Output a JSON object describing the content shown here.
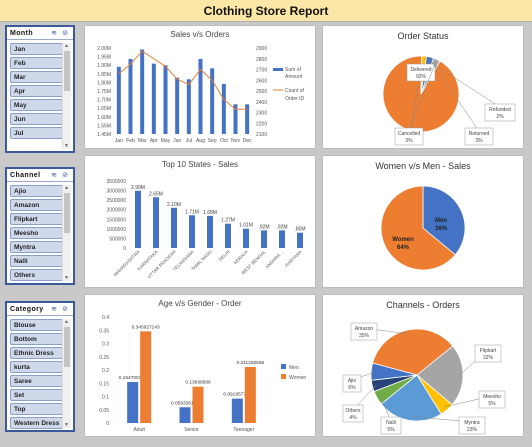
{
  "report": {
    "title": "Clothing Store Report"
  },
  "slicers": {
    "month": {
      "title": "Month",
      "items": [
        "Jan",
        "Feb",
        "Mar",
        "Apr",
        "May",
        "Jun",
        "Jul"
      ]
    },
    "channel": {
      "title": "Channel",
      "items": [
        "Ajio",
        "Amazon",
        "Flipkart",
        "Meesho",
        "Myntra",
        "Nalli",
        "Others"
      ]
    },
    "category": {
      "title": "Category",
      "items": [
        "Blouse",
        "Bottom",
        "Ethnic Dress",
        "kurta",
        "Saree",
        "Set",
        "Top",
        "Western Dress"
      ]
    }
  },
  "panels": {
    "sales_orders": {
      "title": "Sales v/s Orders"
    },
    "order_status": {
      "title": "Order Status"
    },
    "top_states": {
      "title": "Top 10 States - Sales"
    },
    "women_men": {
      "title": "Women v/s Men - Sales"
    },
    "age_gender": {
      "title": "Age v/s Gender - Order"
    },
    "channels": {
      "title": "Channels - Orders"
    }
  },
  "chart_data": [
    {
      "id": "sales_orders",
      "type": "bar",
      "title": "Sales v/s Orders",
      "categories": [
        "Jan",
        "Feb",
        "Mar",
        "Apr",
        "May",
        "Jun",
        "Jul",
        "Aug",
        "Sep",
        "Oct",
        "Nov",
        "Dec"
      ],
      "series": [
        {
          "name": "Sum of Amount",
          "type": "bar",
          "color": "#4472c4",
          "values": [
            1.88,
            1.93,
            1.99,
            1.9,
            1.89,
            1.81,
            1.8,
            1.93,
            1.87,
            1.77,
            1.64,
            1.64
          ]
        },
        {
          "name": "Count of Order ID",
          "type": "line",
          "color": "#ed7d31",
          "values": [
            2660,
            2750,
            2870,
            2800,
            2730,
            2610,
            2560,
            2700,
            2600,
            2420,
            2330,
            2330
          ]
        }
      ],
      "ylim": [
        1.45,
        2.0
      ],
      "y_ticks": [
        "1.45M",
        "1.55M",
        "1.60M",
        "1.65M",
        "1.70M",
        "1.75M",
        "1.80M",
        "1.85M",
        "1.90M",
        "1.95M",
        "2.00M"
      ],
      "y2lim": [
        2100,
        2900
      ],
      "y2_ticks": [
        "2900",
        "2800",
        "2700",
        "2600",
        "2500",
        "2400",
        "2300",
        "2200",
        "2100"
      ]
    },
    {
      "id": "order_status",
      "type": "pie",
      "title": "Order Status",
      "slices": [
        {
          "label": "Delivered",
          "pct_label": "92%",
          "value": 92,
          "color": "#ed7d31"
        },
        {
          "label": "Refunded",
          "pct_label": "2%",
          "value": 2,
          "color": "#ffc000"
        },
        {
          "label": "Returned",
          "pct_label": "3%",
          "value": 3,
          "color": "#4472c4"
        },
        {
          "label": "Cancelled",
          "pct_label": "3%",
          "value": 3,
          "color": "#a5a5a5"
        }
      ]
    },
    {
      "id": "top_states",
      "type": "bar",
      "title": "Top 10 States - Sales",
      "categories": [
        "MAHARASHTRA",
        "KARNATAKA",
        "UTTAR PRADESH",
        "TELANGANA",
        "TAMIL NADU",
        "DELHI",
        "KERALA",
        "WEST BENGAL",
        "ANDHRA ...",
        "HARYANA"
      ],
      "values": [
        2990000,
        2650000,
        2100000,
        1710000,
        1680000,
        1270000,
        1010000,
        920000,
        920000,
        800000
      ],
      "data_labels": [
        "2.99M",
        "2.65M",
        "2.10M",
        "1.71M",
        "1.68M",
        "1.27M",
        "1.01M",
        ".92M",
        ".92M",
        ".80M"
      ],
      "ylim": [
        0,
        3500000
      ],
      "y_ticks": [
        "0",
        "500000",
        "1000000",
        "1500000",
        "2000000",
        "2500000",
        "3000000",
        "3500000"
      ],
      "color": "#4472c4"
    },
    {
      "id": "women_men",
      "type": "pie",
      "title": "Women v/s Men - Sales",
      "slices": [
        {
          "label": "Men",
          "pct_label": "36%",
          "value": 36,
          "color": "#4472c4"
        },
        {
          "label": "Women",
          "pct_label": "64%",
          "value": 64,
          "color": "#ed7d31"
        }
      ]
    },
    {
      "id": "age_gender",
      "type": "bar",
      "title": "Age v/s Gender - Order",
      "categories": [
        "Adult",
        "Senior",
        "Teenager"
      ],
      "series": [
        {
          "name": "Men",
          "color": "#4472c4",
          "values": [
            0.154700307,
            0.059336159,
            0.091957705
          ],
          "labels": [
            "0.154700307",
            "0.059336159",
            "0.091957705"
          ]
        },
        {
          "name": "Women",
          "color": "#ed7d31",
          "values": [
            0.345927143,
            0.13699586,
            0.211292556
          ],
          "labels": [
            "0.345927143",
            "0.13699586",
            "0.211292556"
          ]
        }
      ],
      "ylim": [
        0,
        0.4
      ],
      "y_ticks": [
        "0",
        "0.05",
        "0.1",
        "0.15",
        "0.2",
        "0.25",
        "0.3",
        "0.35",
        "0.4"
      ]
    },
    {
      "id": "channels",
      "type": "pie",
      "title": "Channels - Orders",
      "slices": [
        {
          "label": "Amazon",
          "pct_label": "35%",
          "value": 35,
          "color": "#ed7d31"
        },
        {
          "label": "Flipkart",
          "pct_label": "22%",
          "value": 22,
          "color": "#a5a5a5"
        },
        {
          "label": "Meesho",
          "pct_label": "5%",
          "value": 5,
          "color": "#ffc000"
        },
        {
          "label": "Myntra",
          "pct_label": "23%",
          "value": 23,
          "color": "#5b9bd5"
        },
        {
          "label": "Nalli",
          "pct_label": "5%",
          "value": 5,
          "color": "#70ad47"
        },
        {
          "label": "Others",
          "pct_label": "4%",
          "value": 4,
          "color": "#264478"
        },
        {
          "label": "Ajio",
          "pct_label": "6%",
          "value": 6,
          "color": "#4472c4"
        }
      ]
    }
  ]
}
